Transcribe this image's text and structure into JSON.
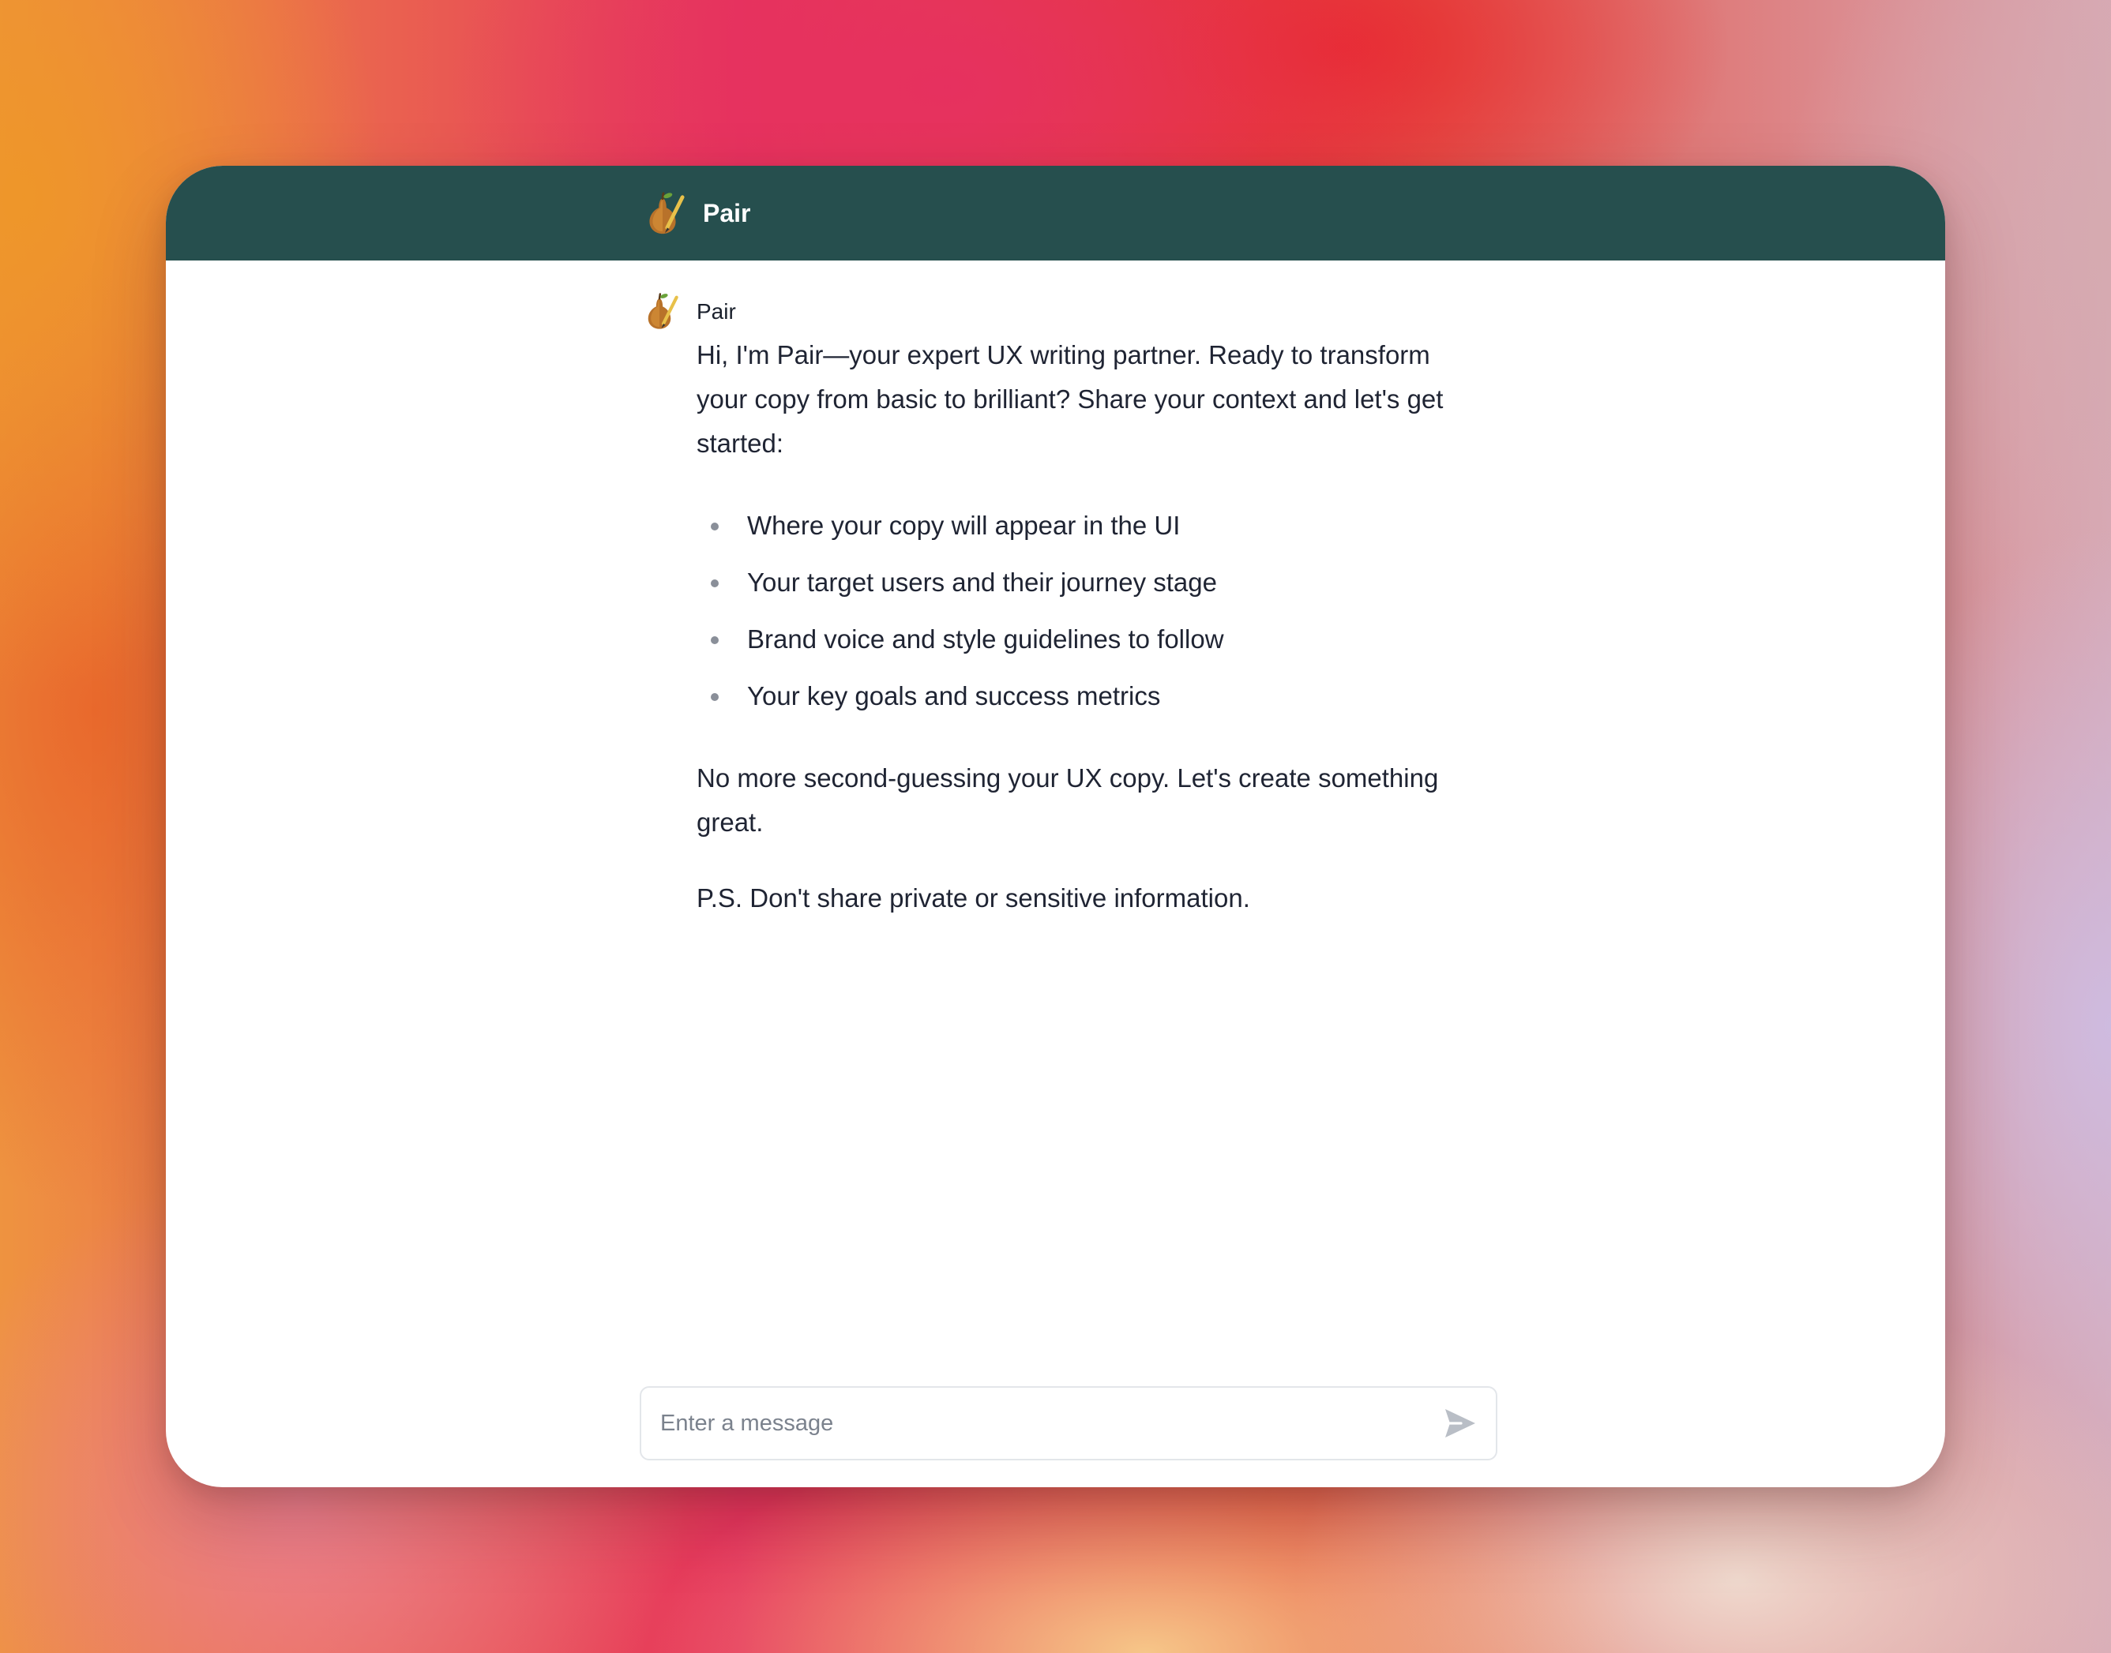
{
  "header": {
    "title": "Pair",
    "logo_icon": "pear-with-pen-icon",
    "background_color": "#264f4e"
  },
  "message": {
    "author": "Pair",
    "avatar_icon": "pear-with-pen-icon",
    "intro": "Hi, I'm Pair—your expert UX writing partner. Ready to transform your copy from basic to brilliant? Share your context and let's get started:",
    "bullets": [
      "Where your copy will appear in the UI",
      "Your target users and their journey stage",
      "Brand voice and style guidelines to follow",
      "Your key goals and success metrics"
    ],
    "closing": "No more second-guessing your UX copy. Let's create something great.",
    "ps": "P.S. Don't share private or sensitive information."
  },
  "composer": {
    "placeholder": "Enter a message",
    "value": "",
    "send_icon": "send-icon"
  },
  "colors": {
    "header": "#264f4e",
    "text": "#1f2433",
    "bullet": "#8a8f99",
    "send_icon": "#b9bec6"
  }
}
